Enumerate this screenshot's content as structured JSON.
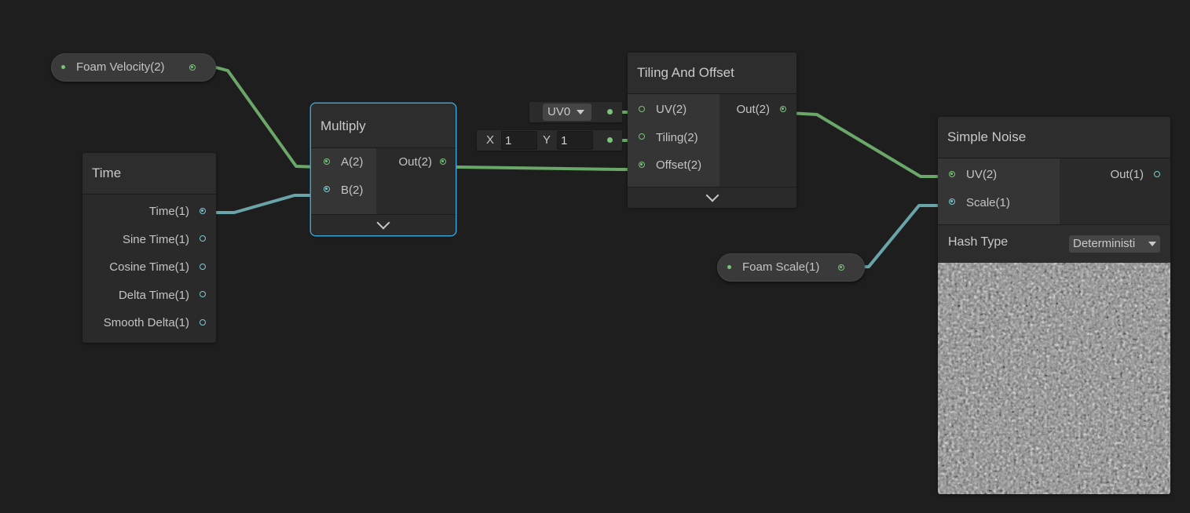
{
  "nodes": {
    "foam_velocity": {
      "label": "Foam Velocity(2)"
    },
    "time": {
      "title": "Time",
      "outputs": [
        "Time(1)",
        "Sine Time(1)",
        "Cosine Time(1)",
        "Delta Time(1)",
        "Smooth Delta(1)"
      ]
    },
    "multiply": {
      "title": "Multiply",
      "inputs": [
        "A(2)",
        "B(2)"
      ],
      "outputs": [
        "Out(2)"
      ]
    },
    "tiling_offset": {
      "title": "Tiling And Offset",
      "inputs": [
        "UV(2)",
        "Tiling(2)",
        "Offset(2)"
      ],
      "outputs": [
        "Out(2)"
      ],
      "uv_dropdown": "UV0",
      "tiling_x_label": "X",
      "tiling_x": "1",
      "tiling_y_label": "Y",
      "tiling_y": "1"
    },
    "simple_noise": {
      "title": "Simple Noise",
      "inputs": [
        "UV(2)",
        "Scale(1)"
      ],
      "outputs": [
        "Out(1)"
      ],
      "hash_type_label": "Hash Type",
      "hash_type_value": "Deterministi"
    },
    "foam_scale": {
      "label": "Foam Scale(1)"
    }
  },
  "colors": {
    "background": "#1e1e1e",
    "vector2_wire": "#7bc27a",
    "float_wire": "#7ec9d0",
    "selected_outline": "#3aa2d6"
  }
}
